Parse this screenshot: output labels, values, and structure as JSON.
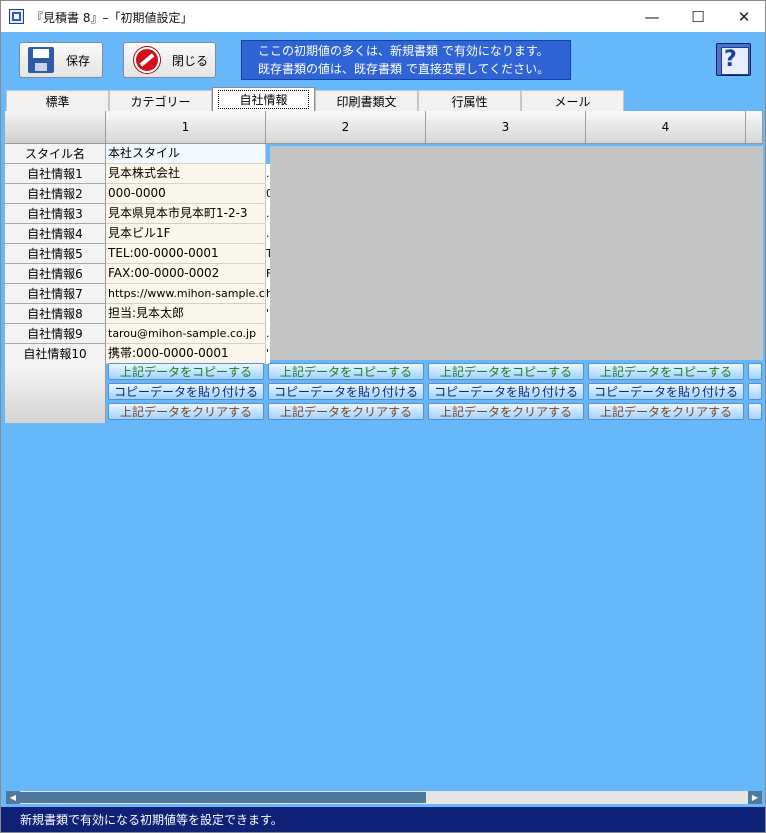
{
  "window": {
    "title": "『見積書 8』–「初期値設定」",
    "minimize": "—",
    "maximize": "☐",
    "close": "✕"
  },
  "toolbar": {
    "save_label": "保存",
    "close_label": "閉じる",
    "help_label": "?"
  },
  "info": {
    "line1": "ここの初期値の多くは、新規書類 で有効になります。",
    "line2": "既存書類の値は、既存書類 で直接変更してください。"
  },
  "tabs": [
    "標準",
    "カテゴリー",
    "自社情報",
    "印刷書類文",
    "行属性",
    "メール"
  ],
  "active_tab": "自社情報",
  "grid": {
    "columns": [
      "1",
      "2",
      "3",
      "4"
    ],
    "rows": [
      {
        "label": "スタイル名",
        "value": "本社スタイル"
      },
      {
        "label": "自社情報1",
        "value": "見本株式会社",
        "edge": "."
      },
      {
        "label": "自社情報2",
        "value": "000-0000",
        "edge": "0"
      },
      {
        "label": "自社情報3",
        "value": "見本県見本市見本町1-2-3",
        "edge": "."
      },
      {
        "label": "自社情報4",
        "value": "見本ビル1F",
        "edge": "."
      },
      {
        "label": "自社情報5",
        "value": "TEL:00-0000-0001",
        "edge": "T"
      },
      {
        "label": "自社情報6",
        "value": "FAX:00-0000-0002",
        "edge": "F"
      },
      {
        "label": "自社情報7",
        "value": "https://www.mihon-sample.c",
        "edge": "h"
      },
      {
        "label": "自社情報8",
        "value": "担当:見本太郎",
        "edge": "'"
      },
      {
        "label": "自社情報9",
        "value": "tarou@mihon-sample.co.jp",
        "edge": "."
      },
      {
        "label": "自社情報10",
        "value": "携帯:000-0000-0001",
        "edge": "'"
      }
    ],
    "actions": {
      "copy": "上記データをコピーする",
      "paste": "コピーデータを貼り付ける",
      "clear": "上記データをクリアする"
    }
  },
  "status": "新規書類で有効になる初期値等を設定できます。",
  "scroll": {
    "left_arrow": "◀",
    "right_arrow": "▶"
  }
}
